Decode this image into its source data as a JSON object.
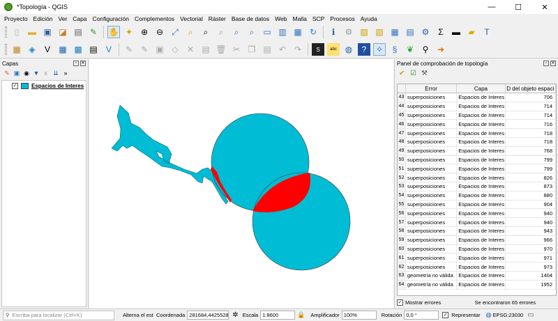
{
  "window": {
    "title": "*Topología - QGIS",
    "min": "—",
    "max": "☐",
    "close": "✕"
  },
  "menu": [
    "Proyecto",
    "Edición",
    "Ver",
    "Capa",
    "Configuración",
    "Complementos",
    "Vectorial",
    "Ráster",
    "Base de datos",
    "Web",
    "Malla",
    "SCP",
    "Procesos",
    "Ayuda"
  ],
  "layers_panel": {
    "title": "Capas",
    "layers": [
      {
        "name": "Espacios de Interes",
        "checked": true,
        "color": "#00bcd4"
      }
    ]
  },
  "topology_panel": {
    "title": "Panel de comprobación de topología",
    "columns": [
      "Error",
      "Capa",
      "D del objeto espaci"
    ],
    "rows": [
      {
        "n": "43",
        "error": "superposiciones",
        "layer": "Espacios de Interes",
        "id": "706"
      },
      {
        "n": "44",
        "error": "superposiciones",
        "layer": "Espacios de Interes",
        "id": "714"
      },
      {
        "n": "45",
        "error": "superposiciones",
        "layer": "Espacios de Interes",
        "id": "714"
      },
      {
        "n": "46",
        "error": "superposiciones",
        "layer": "Espacios de Interes",
        "id": "716"
      },
      {
        "n": "47",
        "error": "superposiciones",
        "layer": "Espacios de Interes",
        "id": "718"
      },
      {
        "n": "48",
        "error": "superposiciones",
        "layer": "Espacios de Interes",
        "id": "718"
      },
      {
        "n": "49",
        "error": "superposiciones",
        "layer": "Espacios de Interes",
        "id": "768"
      },
      {
        "n": "50",
        "error": "superposiciones",
        "layer": "Espacios de Interes",
        "id": "799"
      },
      {
        "n": "51",
        "error": "superposiciones",
        "layer": "Espacios de Interes",
        "id": "799"
      },
      {
        "n": "52",
        "error": "superposiciones",
        "layer": "Espacios de Interes",
        "id": "826"
      },
      {
        "n": "53",
        "error": "superposiciones",
        "layer": "Espacios de Interes",
        "id": "873"
      },
      {
        "n": "54",
        "error": "superposiciones",
        "layer": "Espacios de Interes",
        "id": "880"
      },
      {
        "n": "55",
        "error": "superposiciones",
        "layer": "Espacios de Interes",
        "id": "904"
      },
      {
        "n": "56",
        "error": "superposiciones",
        "layer": "Espacios de Interes",
        "id": "940"
      },
      {
        "n": "57",
        "error": "superposiciones",
        "layer": "Espacios de Interes",
        "id": "940"
      },
      {
        "n": "58",
        "error": "superposiciones",
        "layer": "Espacios de Interes",
        "id": "943"
      },
      {
        "n": "59",
        "error": "superposiciones",
        "layer": "Espacios de Interes",
        "id": "966"
      },
      {
        "n": "60",
        "error": "superposiciones",
        "layer": "Espacios de Interes",
        "id": "970"
      },
      {
        "n": "61",
        "error": "superposiciones",
        "layer": "Espacios de Interes",
        "id": "971"
      },
      {
        "n": "62",
        "error": "superposiciones",
        "layer": "Espacios de Interes",
        "id": "973"
      },
      {
        "n": "63",
        "error": "geometría no válida",
        "layer": "Espacios de Interes",
        "id": "1404"
      },
      {
        "n": "64",
        "error": "geometría no válida",
        "layer": "Espacios de Interes",
        "id": "1952"
      }
    ],
    "show_errors_label": "Mostrar errores",
    "found_label": "Se encontraron 65 errores"
  },
  "status": {
    "locator_placeholder": "Escriba para localizar (Ctrl+K)",
    "toggle_label": "Alterna el esta",
    "coord_label": "Coordenada",
    "coord_value": "281684,4425528",
    "scale_label": "Escala",
    "scale_value": "1:8600",
    "magnifier_label": "Amplificador",
    "magnifier_value": "100%",
    "rotation_label": "Rotación",
    "rotation_value": "0,0 °",
    "render_label": "Representar",
    "crs_label": "EPSG:23030"
  },
  "colors": {
    "feature": "#00bcd4",
    "error": "#ff0000"
  }
}
